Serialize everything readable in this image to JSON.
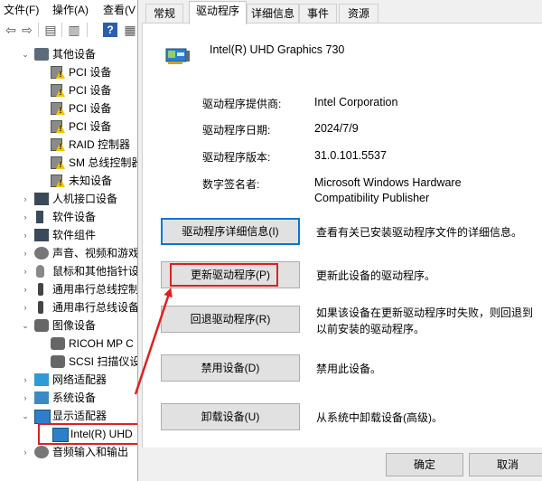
{
  "menubar": {
    "items": [
      "文件(F)",
      "操作(A)",
      "查看(V"
    ]
  },
  "tree": {
    "items": [
      {
        "label": "其他设备",
        "expanded": true,
        "icon": "other-devices-icon"
      },
      {
        "label": "PCI 设备",
        "icon": "warning-device-icon"
      },
      {
        "label": "PCI 设备",
        "icon": "warning-device-icon"
      },
      {
        "label": "PCI 设备",
        "icon": "warning-device-icon"
      },
      {
        "label": "PCI 设备",
        "icon": "warning-device-icon"
      },
      {
        "label": "RAID 控制器",
        "icon": "warning-device-icon"
      },
      {
        "label": "SM 总线控制器",
        "icon": "warning-device-icon"
      },
      {
        "label": "未知设备",
        "icon": "warning-device-icon"
      },
      {
        "label": "人机接口设备",
        "icon": "hid-icon"
      },
      {
        "label": "软件设备",
        "icon": "software-device-icon"
      },
      {
        "label": "软件组件",
        "icon": "software-component-icon"
      },
      {
        "label": "声音、视频和游戏",
        "icon": "audio-icon"
      },
      {
        "label": "鼠标和其他指针设",
        "icon": "mouse-icon"
      },
      {
        "label": "通用串行总线控制",
        "icon": "usb-icon"
      },
      {
        "label": "通用串行总线设备",
        "icon": "usb-icon"
      },
      {
        "label": "图像设备",
        "expanded": true,
        "icon": "camera-icon"
      },
      {
        "label": "RICOH MP C",
        "icon": "scanner-icon"
      },
      {
        "label": "SCSI 扫描仪设",
        "icon": "scanner-icon"
      },
      {
        "label": "网络适配器",
        "icon": "network-icon"
      },
      {
        "label": "系统设备",
        "icon": "system-icon"
      },
      {
        "label": "显示适配器",
        "expanded": true,
        "icon": "display-adapter-icon"
      },
      {
        "label": "Intel(R) UHD",
        "icon": "display-adapter-icon"
      },
      {
        "label": "音频输入和输出",
        "icon": "audio-io-icon"
      }
    ]
  },
  "dialog": {
    "tabs": [
      "常规",
      "驱动程序",
      "详细信息",
      "事件",
      "资源"
    ],
    "active_tab": "驱动程序",
    "device_name": "Intel(R) UHD Graphics 730",
    "info": {
      "provider_label": "驱动程序提供商:",
      "provider_value": "Intel Corporation",
      "date_label": "驱动程序日期:",
      "date_value": "2024/7/9",
      "version_label": "驱动程序版本:",
      "version_value": "31.0.101.5537",
      "signer_label": "数字签名者:",
      "signer_value_line1": "Microsoft Windows Hardware",
      "signer_value_line2": "Compatibility Publisher"
    },
    "actions": {
      "details_label": "驱动程序详细信息(I)",
      "details_desc": "查看有关已安装驱动程序文件的详细信息。",
      "update_label": "更新驱动程序(P)",
      "update_desc": "更新此设备的驱动程序。",
      "rollback_label": "回退驱动程序(R)",
      "rollback_desc": "如果该设备在更新驱动程序时失败，则回退到以前安装的驱动程序。",
      "disable_label": "禁用设备(D)",
      "disable_desc": "禁用此设备。",
      "uninstall_label": "卸载设备(U)",
      "uninstall_desc": "从系统中卸载设备(高级)。"
    },
    "footer": {
      "ok_label": "确定",
      "cancel_label": "取消"
    }
  },
  "annotation_color": "#e02020"
}
